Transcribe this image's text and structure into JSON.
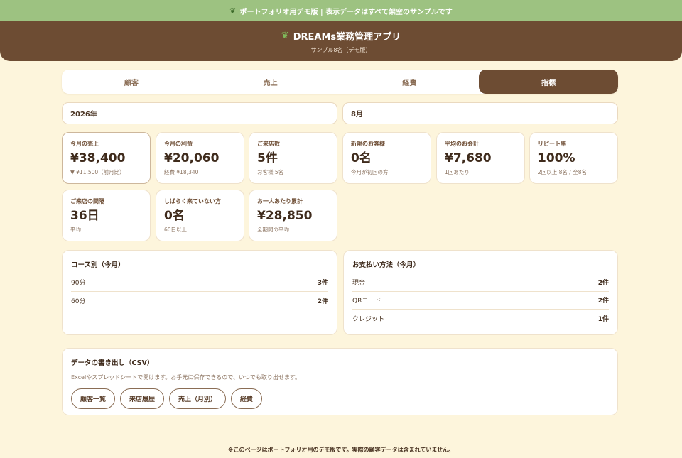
{
  "banner": {
    "icon": "leaf-icon",
    "text": "ポートフォリオ用デモ版 | 表示データはすべて架空のサンプルです"
  },
  "header": {
    "icon": "leaf-icon",
    "title": "DREAMs業務管理アプリ",
    "subtitle": "サンプル8名（デモ版）"
  },
  "tabs": [
    {
      "label": "顧客",
      "active": false
    },
    {
      "label": "売上",
      "active": false
    },
    {
      "label": "経費",
      "active": false
    },
    {
      "label": "指標",
      "active": true
    }
  ],
  "filters": {
    "year": "2026年",
    "month": "8月"
  },
  "stats": [
    {
      "label": "今月の売上",
      "value": "¥38,400",
      "sub": "▼ ¥11,500（前月比）"
    },
    {
      "label": "今月の利益",
      "value": "¥20,060",
      "sub": "経費 ¥18,340"
    },
    {
      "label": "ご来店数",
      "value": "5件",
      "sub": "お客様 5名"
    },
    {
      "label": "新規のお客様",
      "value": "0名",
      "sub": "今月が初回の方"
    },
    {
      "label": "平均のお会計",
      "value": "¥7,680",
      "sub": "1回あたり"
    },
    {
      "label": "リピート率",
      "value": "100%",
      "sub": "2回以上 8名 / 全8名"
    },
    {
      "label": "ご来店の間隔",
      "value": "36日",
      "sub": "平均"
    },
    {
      "label": "しばらく来ていない方",
      "value": "0名",
      "sub": "60日以上"
    },
    {
      "label": "お一人あたり累計",
      "value": "¥28,850",
      "sub": "全期間の平均"
    }
  ],
  "course_panel": {
    "title": "コース別（今月）",
    "rows": [
      {
        "name": "90分",
        "count": "3件"
      },
      {
        "name": "60分",
        "count": "2件"
      }
    ]
  },
  "payment_panel": {
    "title": "お支払い方法（今月）",
    "rows": [
      {
        "name": "現金",
        "count": "2件"
      },
      {
        "name": "QRコード",
        "count": "2件"
      },
      {
        "name": "クレジット",
        "count": "1件"
      }
    ]
  },
  "export": {
    "title": "データの書き出し（CSV）",
    "description": "Excelやスプレッドシートで開けます。お手元に保存できるので、いつでも取り出せます。",
    "buttons": [
      "顧客一覧",
      "来店履歴",
      "売上（月別）",
      "経費"
    ]
  },
  "footer": "※このページはポートフォリオ用のデモ版です。実際の顧客データは含まれていません。"
}
